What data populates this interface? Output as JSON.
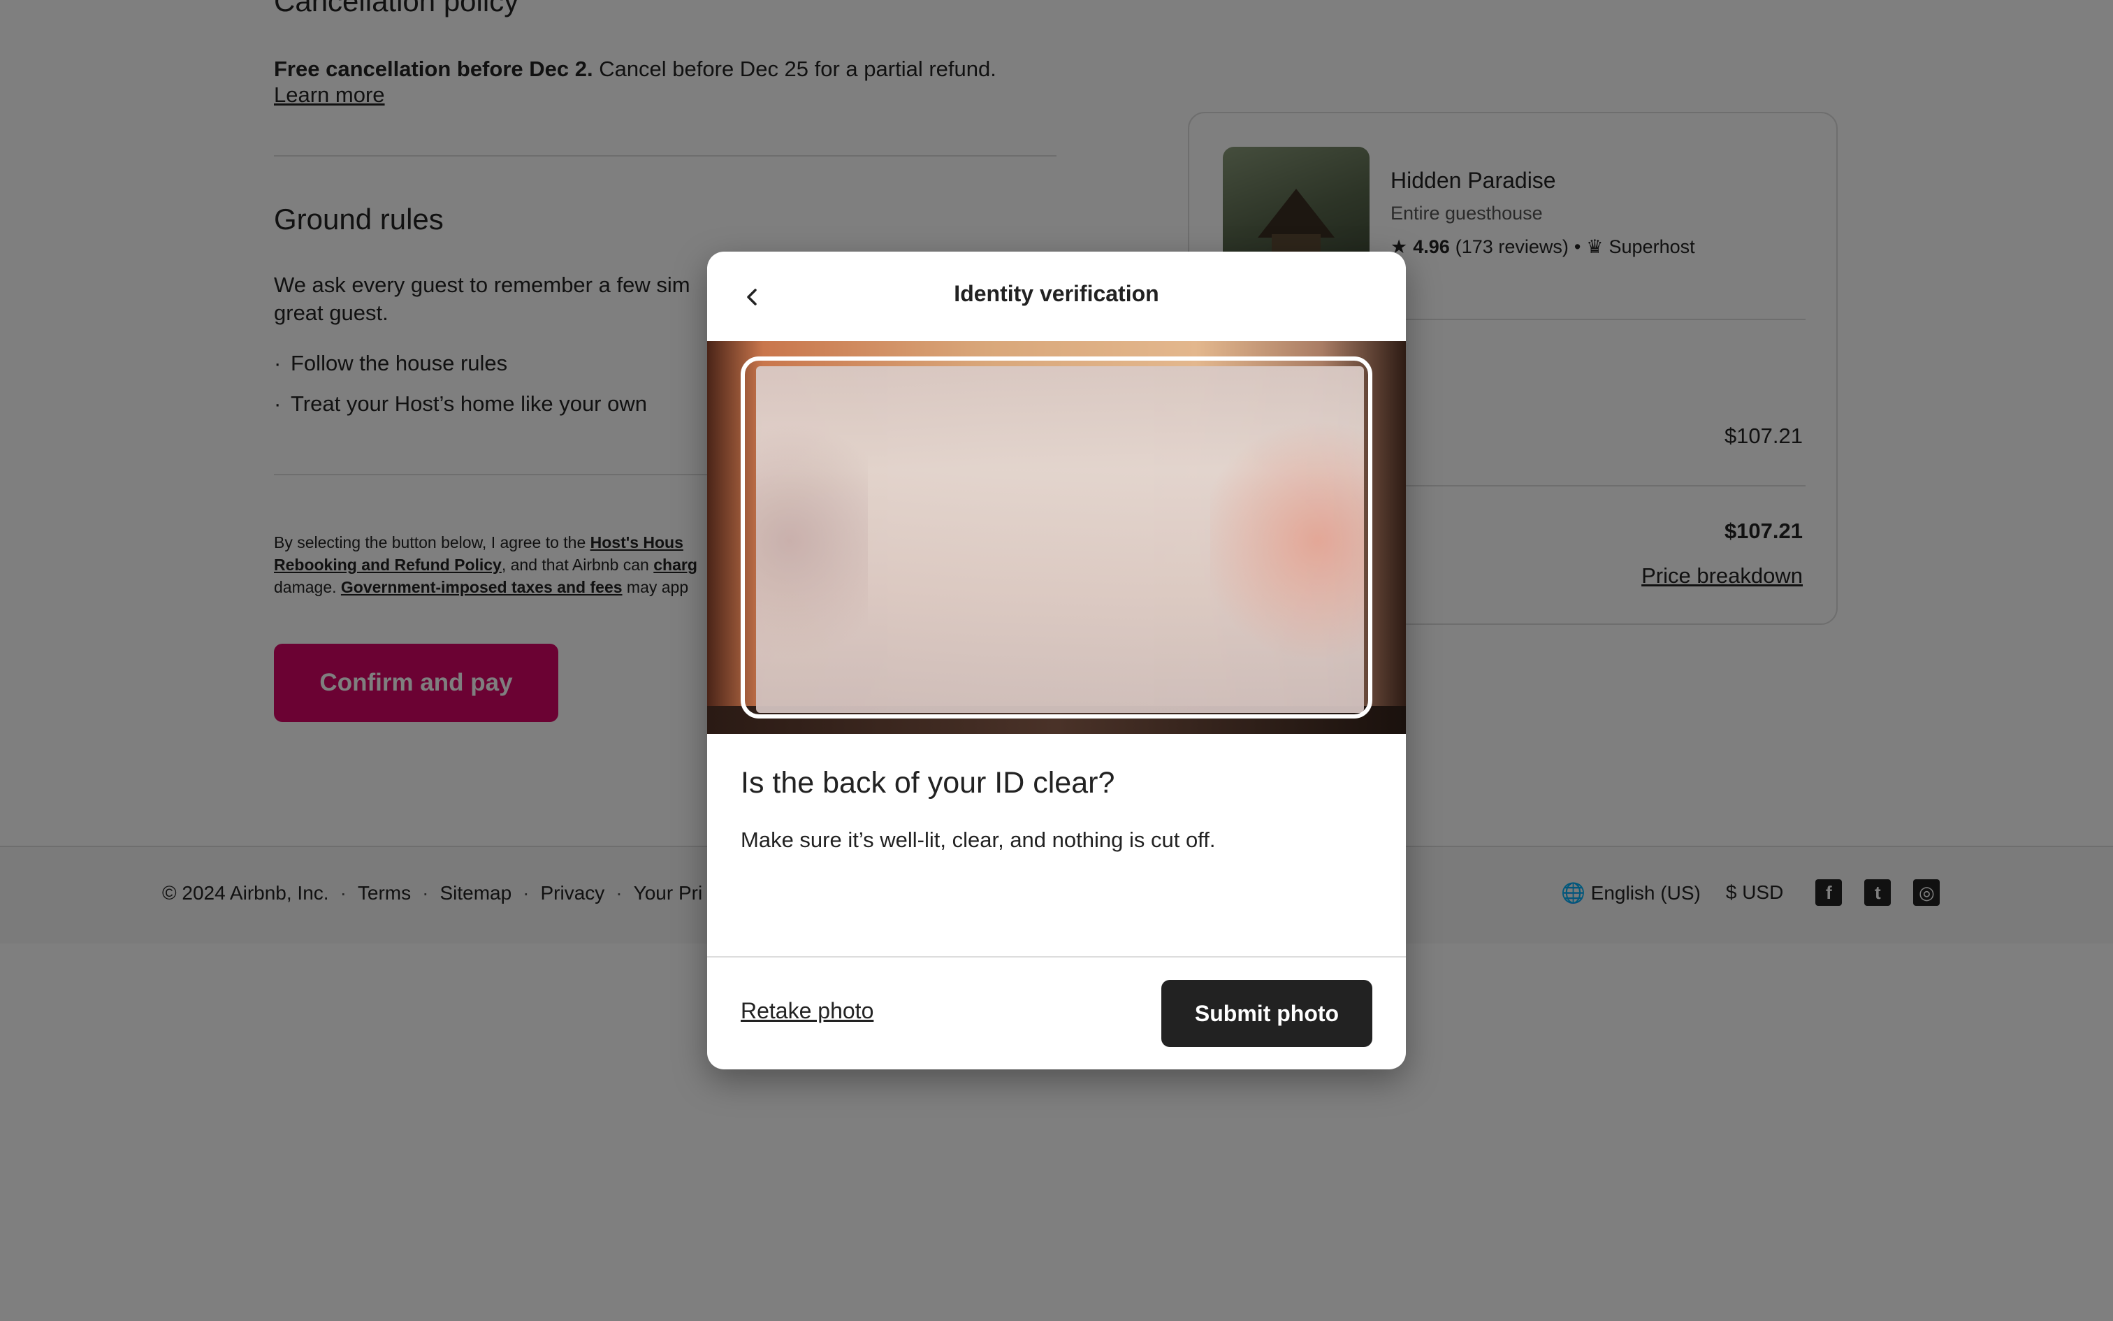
{
  "background": {
    "cancellation": {
      "title": "Cancellation policy",
      "bold": "Free cancellation before Dec 2.",
      "text": " Cancel before Dec 25 for a partial refund.",
      "learn_more": "Learn more"
    },
    "ground_rules": {
      "title": "Ground rules",
      "intro_line1": "We ask every guest to remember a few sim",
      "intro_line2": "great guest.",
      "items": [
        "Follow the house rules",
        "Treat your Host’s home like your own"
      ]
    },
    "legal": {
      "p1": "By selecting the button below, I agree to the ",
      "link1": "Host's Hous",
      "link2": "Rebooking and Refund Policy",
      "p2": ", and that Airbnb can ",
      "link3": "charg",
      "p3": "damage. ",
      "link4": "Government-imposed taxes and fees",
      "p4": " may app"
    },
    "confirm_button": "Confirm and pay",
    "card": {
      "title": "Hidden Paradise",
      "type": "Entire guesthouse",
      "rating": "4.96",
      "reviews": "(173 reviews)",
      "bullet": "•",
      "superhost": "Superhost",
      "price1": "$107.21",
      "price2": "$107.21",
      "price_breakdown": "Price breakdown"
    },
    "footer": {
      "copyright": "© 2024 Airbnb, Inc.",
      "links": [
        "Terms",
        "Sitemap",
        "Privacy",
        "Your Pri"
      ],
      "sep": "·",
      "language": "English (US)",
      "currency_symbol": "$",
      "currency": "USD",
      "social": [
        "facebook-icon",
        "twitter-icon",
        "instagram-icon"
      ]
    }
  },
  "modal": {
    "title": "Identity verification",
    "question": "Is the back of your ID clear?",
    "help": "Make sure it’s well-lit, clear, and nothing is cut off.",
    "retake": "Retake photo",
    "submit": "Submit photo"
  },
  "colors": {
    "brand": "#d70466",
    "dark_button": "#222222",
    "overlay": "rgba(0,0,0,0.5)"
  }
}
